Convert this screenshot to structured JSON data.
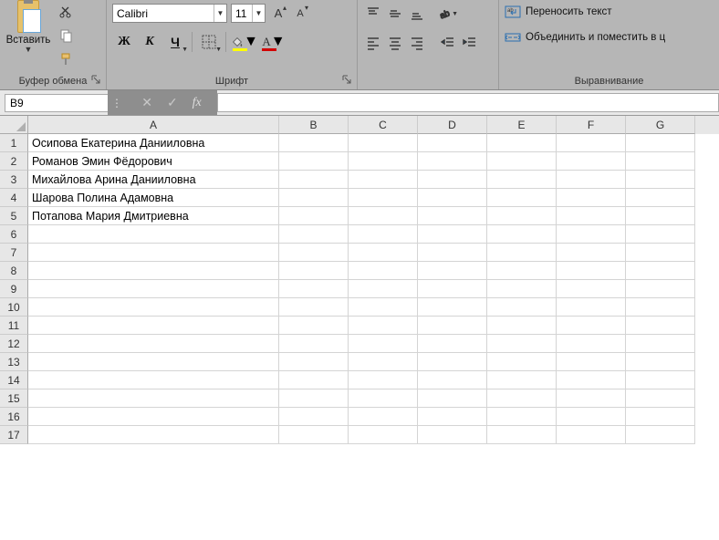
{
  "ribbon": {
    "clipboard": {
      "paste_label": "Вставить",
      "group_label": "Буфер обмена"
    },
    "font": {
      "name": "Calibri",
      "size": "11",
      "bold": "Ж",
      "italic": "К",
      "underline": "Ч",
      "fontcolor_letter": "А",
      "group_label": "Шрифт"
    },
    "align": {
      "group_label": "Выравнивание"
    },
    "wrap": {
      "wrap_label": "Переносить текст",
      "merge_label": "Объединить и поместить в ц"
    }
  },
  "formula_bar": {
    "namebox": "B9",
    "fx_label": "fx",
    "input": ""
  },
  "columns": [
    "A",
    "B",
    "C",
    "D",
    "E",
    "F",
    "G"
  ],
  "row_headers": [
    "1",
    "2",
    "3",
    "4",
    "5",
    "6",
    "7",
    "8",
    "9",
    "10",
    "11",
    "12",
    "13",
    "14",
    "15",
    "16",
    "17"
  ],
  "cells_A": [
    "Осипова Екатерина Данииловна",
    "Романов Эмин Фёдорович",
    "Михайлова Арина Данииловна",
    "Шарова Полина Адамовна",
    "Потапова Мария Дмитриевна",
    "",
    "",
    "",
    "",
    "",
    "",
    "",
    "",
    "",
    "",
    "",
    ""
  ]
}
